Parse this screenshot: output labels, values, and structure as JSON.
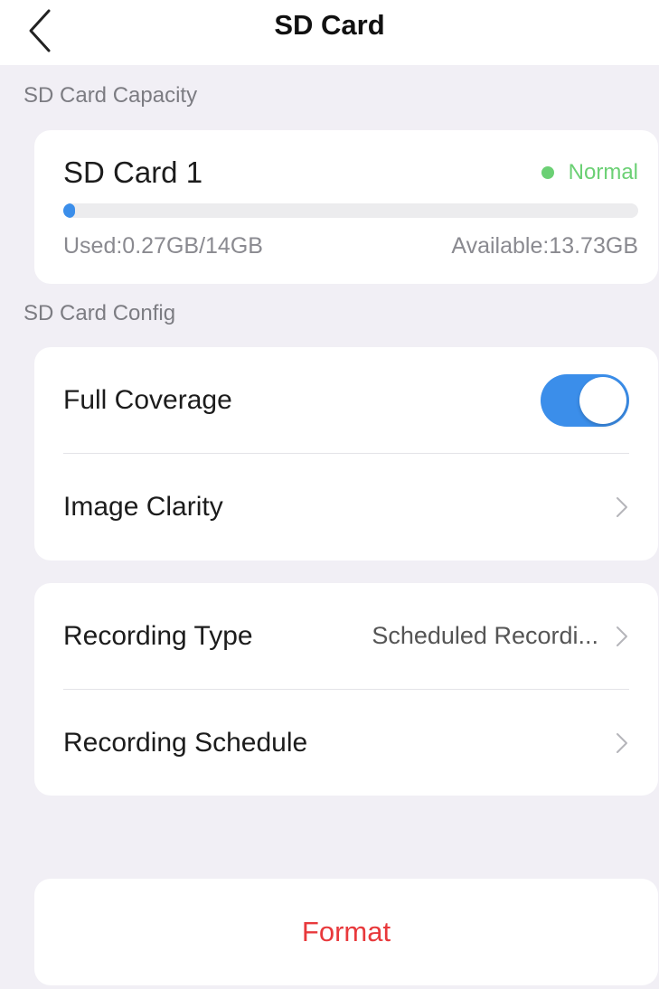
{
  "header": {
    "title": "SD Card",
    "back_icon": "chevron-left-icon"
  },
  "capacity_section": {
    "label": "SD Card Capacity",
    "card": {
      "name": "SD Card 1",
      "status": "Normal",
      "status_color": "#6bd074",
      "used_text": "Used:0.27GB/14GB",
      "available_text": "Available:13.73GB",
      "used_fraction": 0.0193,
      "accent_color": "#3b8eea"
    }
  },
  "config_section": {
    "label": "SD Card Config",
    "full_coverage": {
      "label": "Full Coverage",
      "enabled": true
    },
    "image_clarity": {
      "label": "Image Clarity"
    },
    "recording_type": {
      "label": "Recording Type",
      "value": "Scheduled Recordi..."
    },
    "recording_schedule": {
      "label": "Recording Schedule"
    }
  },
  "format_button": {
    "label": "Format",
    "color": "#e8393c"
  }
}
